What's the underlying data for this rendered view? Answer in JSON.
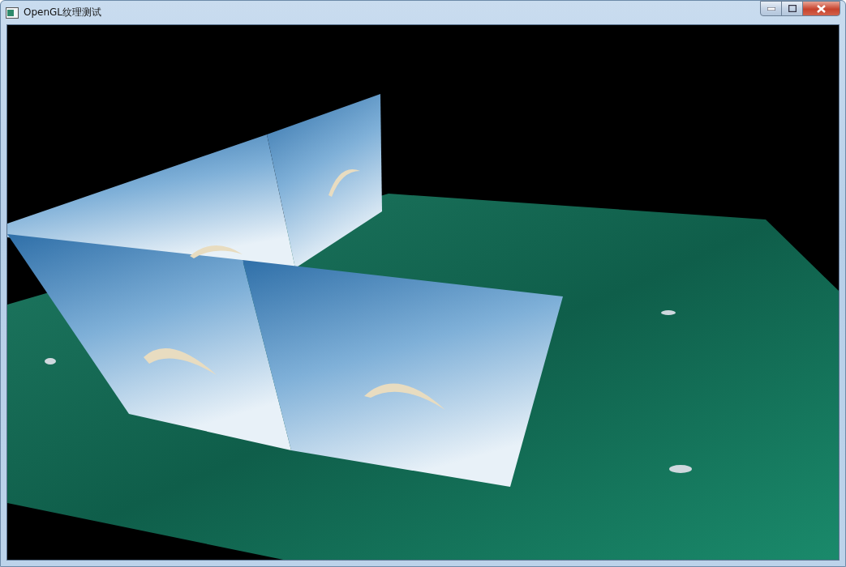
{
  "window": {
    "title": "OpenGL纹理测试"
  }
}
